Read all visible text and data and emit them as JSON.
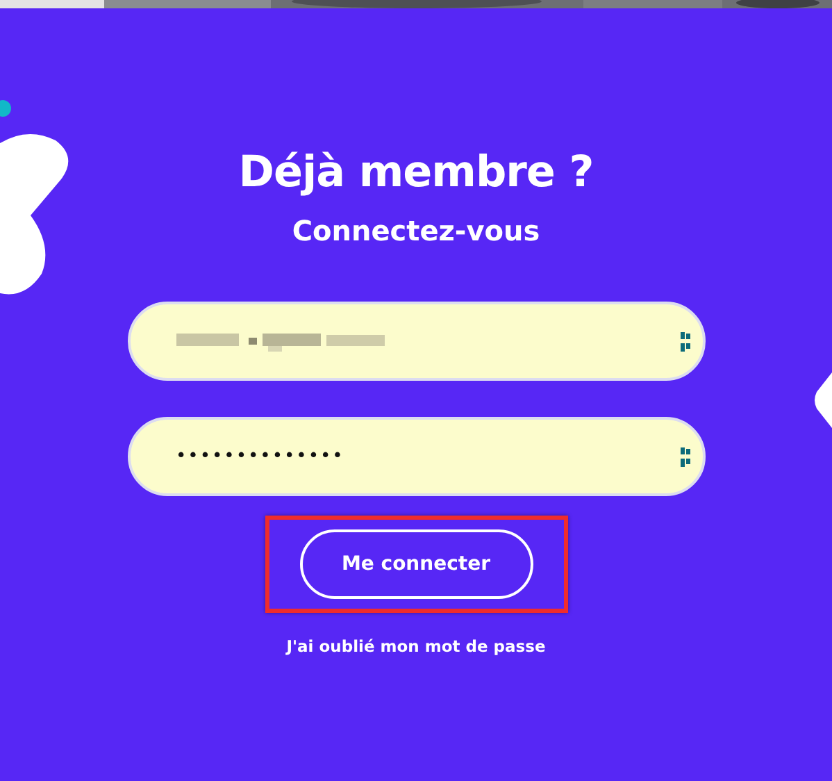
{
  "heading": "Déjà membre ?",
  "subheading": "Connectez-vous",
  "fields": [
    {
      "kind": "blurred"
    },
    {
      "kind": "masked",
      "value": "••••••••••••••"
    }
  ],
  "submit_button": {
    "label": "Me connecter",
    "highlighted": true
  },
  "forgot_link": "J'ai oublié mon mot de passe"
}
